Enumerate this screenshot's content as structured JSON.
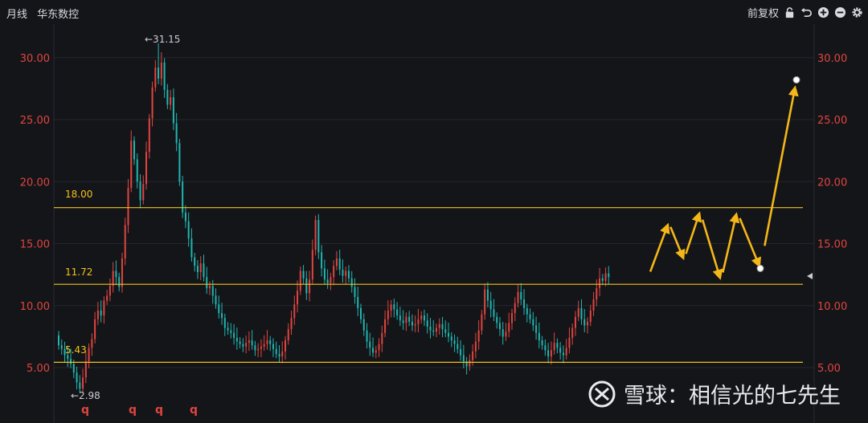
{
  "header": {
    "period": "月线",
    "stock_name": "华东数控",
    "adjust_label": "前复权",
    "icons": [
      "lock-icon",
      "undo-icon",
      "zoom-in-icon",
      "zoom-out-icon",
      "gear-icon"
    ]
  },
  "watermark": {
    "text": "雪球：相信光的七先生"
  },
  "chart_data": {
    "type": "candlestick",
    "y_ticks": [
      "30.00",
      "25.00",
      "20.00",
      "15.00",
      "10.00",
      "5.00"
    ],
    "ylim": [
      3.5,
      32.5
    ],
    "annotations": {
      "high": {
        "label": "←31.15",
        "value": 31.15
      },
      "low": {
        "label": "←2.98",
        "value": 2.98
      }
    },
    "levels": [
      {
        "label": "18.00",
        "value": 17.9
      },
      {
        "label": "11.72",
        "value": 11.72
      },
      {
        "label": "5.43",
        "value": 5.43
      }
    ],
    "markers": [
      "q",
      "q",
      "q",
      "q"
    ],
    "colors": {
      "up": "#e0453f",
      "down": "#1fb6b0",
      "level": "#f2c21b",
      "arrow": "#f4b717"
    },
    "projection_path": [
      12.2,
      16.7,
      13.7,
      17.6,
      12.0,
      17.6,
      13.0,
      28.2
    ],
    "closes": [
      6.8,
      6.5,
      6.0,
      5.7,
      5.3,
      4.6,
      3.8,
      3.3,
      4.2,
      5.5,
      6.6,
      7.3,
      8.9,
      9.6,
      9.2,
      10.4,
      10.8,
      11.6,
      12.8,
      12.3,
      11.5,
      13.8,
      16.5,
      19.5,
      23.3,
      21.8,
      20.0,
      18.5,
      19.8,
      22.4,
      25.1,
      27.6,
      29.2,
      28.3,
      29.6,
      27.4,
      26.2,
      26.8,
      24.7,
      23.1,
      20.0,
      17.5,
      16.8,
      15.4,
      13.9,
      13.2,
      12.7,
      13.4,
      12.3,
      11.4,
      11.6,
      10.8,
      10.1,
      9.4,
      9.0,
      8.2,
      8.0,
      7.8,
      7.4,
      7.1,
      6.9,
      6.7,
      7.0,
      7.2,
      6.8,
      6.4,
      6.5,
      6.7,
      6.9,
      7.2,
      6.9,
      6.5,
      6.1,
      5.9,
      6.3,
      7.2,
      8.1,
      9.0,
      10.1,
      11.2,
      12.8,
      12.2,
      11.0,
      12.1,
      14.5,
      16.9,
      14.3,
      13.0,
      12.1,
      11.8,
      12.3,
      13.2,
      13.8,
      12.9,
      12.4,
      12.8,
      12.2,
      11.5,
      10.7,
      9.8,
      8.9,
      8.0,
      7.1,
      6.6,
      6.2,
      6.4,
      6.9,
      7.8,
      8.9,
      9.6,
      10.1,
      9.7,
      9.2,
      8.8,
      8.6,
      9.1,
      8.7,
      8.4,
      8.5,
      8.9,
      9.2,
      8.8,
      8.3,
      8.0,
      7.9,
      8.2,
      8.5,
      8.1,
      7.8,
      7.5,
      7.2,
      6.9,
      6.5,
      6.0,
      5.5,
      5.1,
      5.6,
      6.3,
      7.1,
      8.0,
      9.3,
      11.3,
      10.4,
      9.7,
      9.1,
      8.6,
      8.1,
      7.5,
      7.9,
      8.6,
      9.4,
      10.2,
      11.1,
      10.5,
      9.8,
      9.3,
      8.9,
      8.4,
      7.8,
      7.2,
      6.8,
      6.4,
      5.9,
      6.4,
      7.0,
      6.6,
      6.2,
      6.0,
      6.6,
      7.4,
      8.2,
      9.1,
      9.8,
      8.9,
      8.4,
      8.7,
      9.6,
      10.5,
      11.4,
      12.2,
      12.0,
      12.6,
      12.3
    ]
  }
}
